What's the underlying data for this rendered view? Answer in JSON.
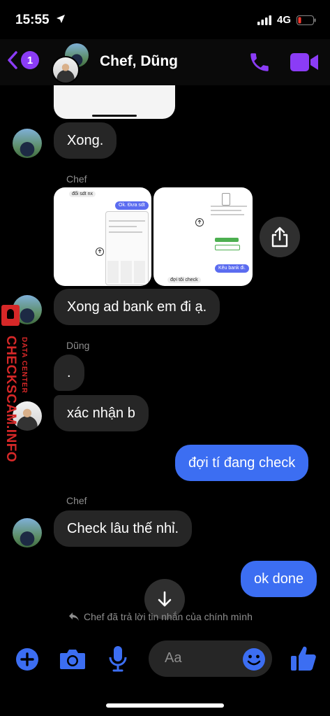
{
  "status": {
    "time": "15:55",
    "network": "4G"
  },
  "header": {
    "back_badge": "1",
    "title": "Chef, Dũng"
  },
  "messages": {
    "m1": "Xong.",
    "sender_chef_1": "Chef",
    "shot1_top": "đổi sdt nx",
    "shot1_btn": "Ok. Đưa sdt",
    "shot2_btn": "Kêu bank đi.",
    "shot2_bottom": "đợi tôi check",
    "m2": "Xong ad bank em đi ạ.",
    "sender_dung": "Dũng",
    "m3": ".",
    "m4": "xác nhận b",
    "m5": "đợi tí đang check",
    "sender_chef_2": "Chef",
    "m6": "Check lâu thế nhỉ.",
    "m7": "ok done",
    "reply_note": "Chef đã trả lời tin nhắn của chính mình"
  },
  "composer": {
    "placeholder": "Aa"
  },
  "watermark": {
    "title": "CHECKSCAM.INFO",
    "subtitle": "DATA CENTER"
  },
  "colors": {
    "accent": "#8b3cf6",
    "my_bubble": "#3c6ef2",
    "their_bubble": "#262626",
    "composer_icon": "#3c6ef2"
  }
}
